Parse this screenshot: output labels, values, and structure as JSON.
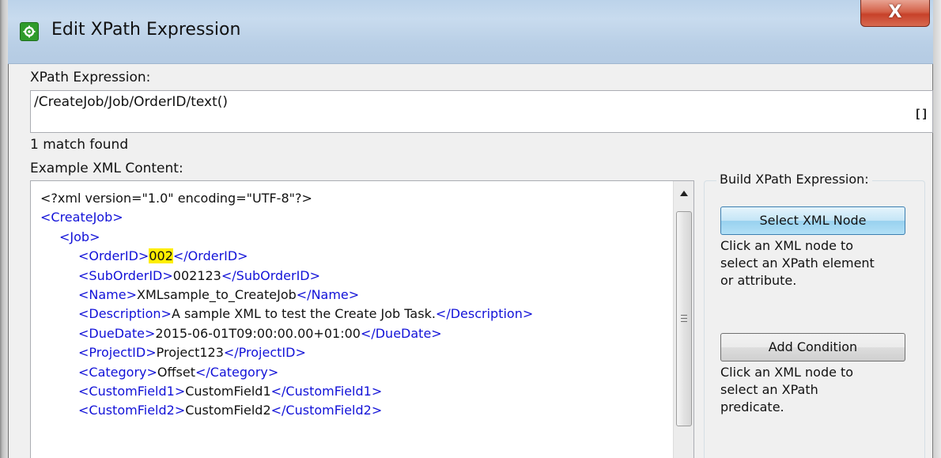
{
  "window": {
    "title": "Edit XPath Expression",
    "close_glyph": "X",
    "app_icon": "gear-icon"
  },
  "xpath": {
    "label": "XPath Expression:",
    "value": "/CreateJob/Job/OrderID/text()",
    "bracket_glyph": "[]"
  },
  "match_status": "1 match found",
  "example": {
    "label": "Example XML Content:",
    "lines": [
      {
        "text": "<?xml version=\"1.0\" encoding=\"UTF-8\"?>"
      },
      {
        "open": "<CreateJob>"
      },
      {
        "open": "<Job>"
      },
      {
        "open": "<OrderID>",
        "value": "002",
        "close": "</OrderID>",
        "highlighted": true
      },
      {
        "open": "<SubOrderID>",
        "value": "002123",
        "close": "</SubOrderID>"
      },
      {
        "open": "<Name>",
        "value": "XMLsample_to_CreateJob",
        "close": "</Name>"
      },
      {
        "open": "<Description>",
        "value": "A sample XML to test the Create Job Task.",
        "close": "</Description>"
      },
      {
        "open": "<DueDate>",
        "value": "2015-06-01T09:00:00.00+01:00",
        "close": "</DueDate>"
      },
      {
        "open": "<ProjectID>",
        "value": "Project123",
        "close": "</ProjectID>"
      },
      {
        "open": "<Category>",
        "value": "Offset",
        "close": "</Category>"
      },
      {
        "open": "<CustomField1>",
        "value": "CustomField1",
        "close": "</CustomField1>"
      },
      {
        "open": "<CustomField2>",
        "value": "CustomField2",
        "close": "</CustomField2>"
      }
    ],
    "highlight_color": "#ffee00",
    "tag_color": "#1212d8"
  },
  "builder": {
    "legend": "Build XPath Expression:",
    "select_node_label": "Select XML Node",
    "select_node_help": [
      "Click an XML node to",
      "select an XPath element",
      "or attribute."
    ],
    "add_condition_label": "Add Condition",
    "add_condition_help": [
      "Click an XML node to",
      "select an XPath",
      "predicate."
    ]
  }
}
